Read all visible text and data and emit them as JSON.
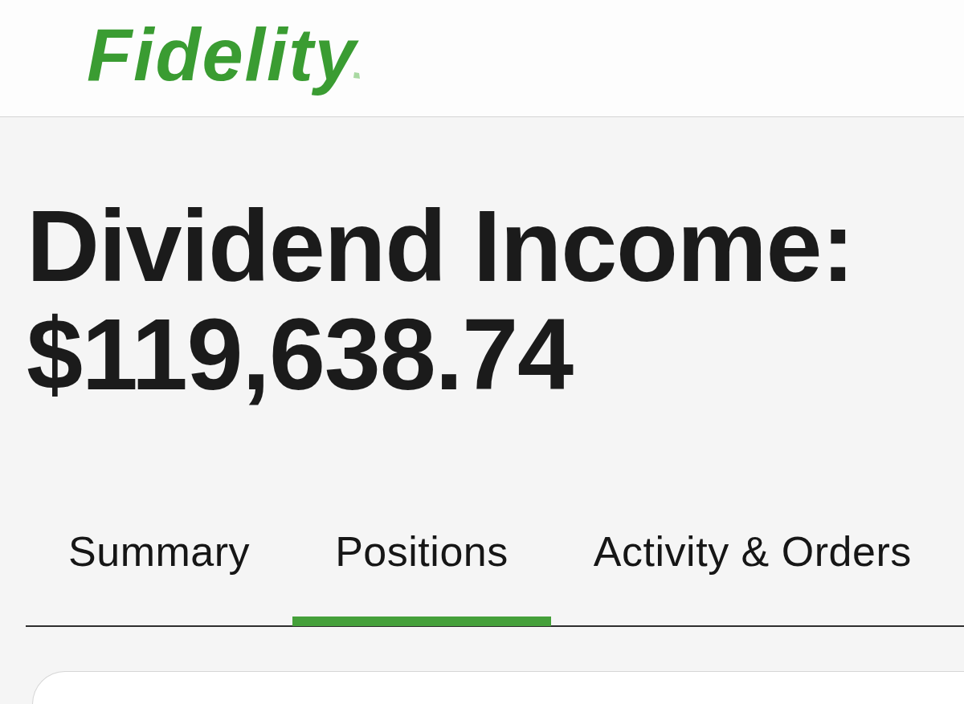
{
  "header": {
    "logo": "Fidelity"
  },
  "summary": {
    "label": "Dividend Income:",
    "amount": "$119,638.74"
  },
  "tabs": [
    {
      "label": "Summary",
      "selected": false
    },
    {
      "label": "Positions",
      "selected": true
    },
    {
      "label": "Activity & Orders",
      "selected": false
    }
  ]
}
